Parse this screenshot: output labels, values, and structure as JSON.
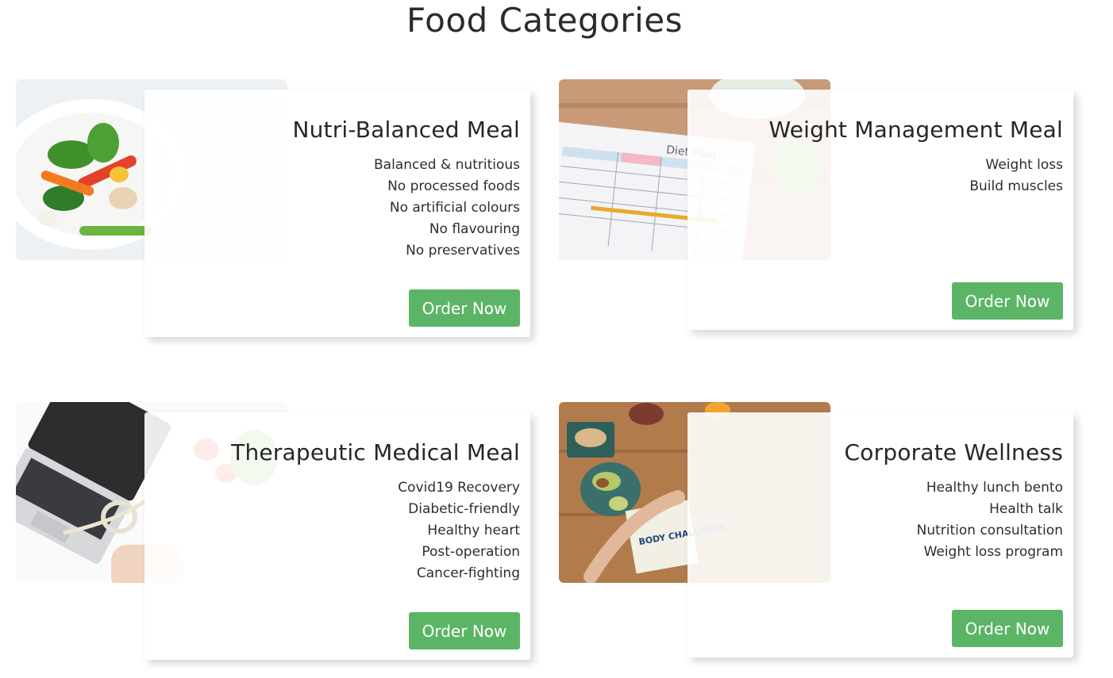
{
  "page": {
    "title": "Food Categories"
  },
  "cards": [
    {
      "title": "Nutri-Balanced Meal",
      "features": [
        "Balanced & nutritious",
        "No processed foods",
        "No artificial colours",
        "No flavouring",
        "No preservatives"
      ],
      "button": "Order Now"
    },
    {
      "title": "Weight Management Meal",
      "features": [
        "Weight loss",
        "Build muscles"
      ],
      "button": "Order Now",
      "photo_text": "Diet Plan"
    },
    {
      "title": "Therapeutic Medical Meal",
      "features": [
        "Covid19 Recovery",
        "Diabetic-friendly",
        "Healthy heart",
        "Post-operation",
        "Cancer-fighting"
      ],
      "button": "Order Now"
    },
    {
      "title": "Corporate Wellness",
      "features": [
        "Healthy lunch bento",
        "Health talk",
        "Nutrition consultation",
        "Weight loss program"
      ],
      "button": "Order Now",
      "photo_text": "BODY CHALLENGE"
    }
  ],
  "colors": {
    "accent": "#5cb566",
    "text": "#262626",
    "background": "#ffffff"
  }
}
